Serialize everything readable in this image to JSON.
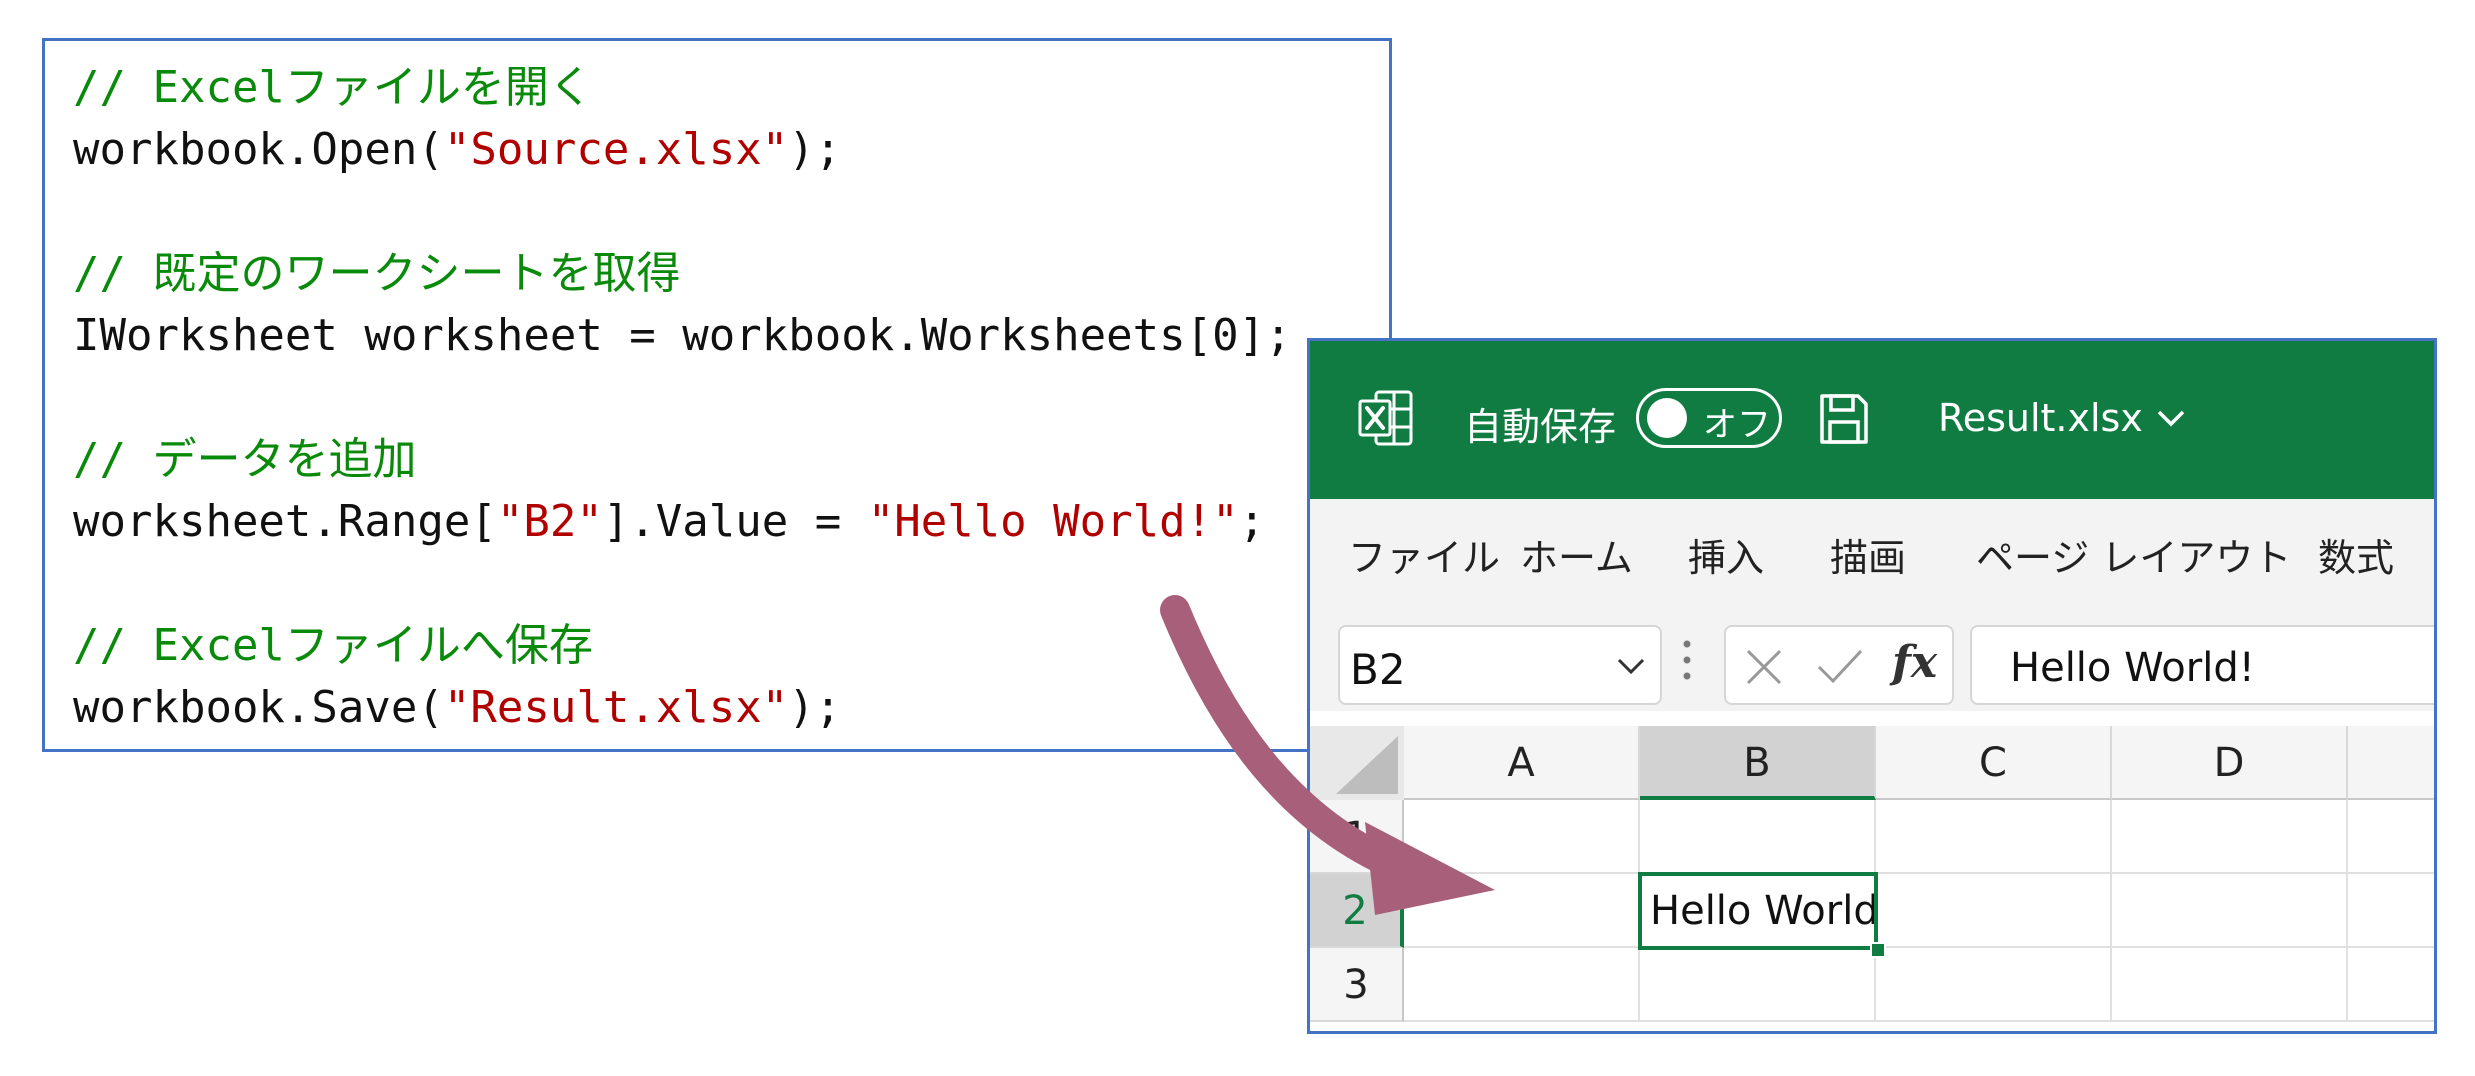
{
  "code": {
    "comment1": "// Excelファイルを開く",
    "line1_pre": "workbook.Open(",
    "line1_str": "\"Source.xlsx\"",
    "line1_post": ");",
    "comment2": "// 既定のワークシートを取得",
    "line2": "IWorksheet worksheet = workbook.Worksheets[0];",
    "comment3": "// データを追加",
    "line3_pre": "worksheet.Range[",
    "line3_str1": "\"B2\"",
    "line3_mid": "].Value = ",
    "line3_str2": "\"Hello World!\"",
    "line3_post": ";",
    "comment4": "// Excelファイルへ保存",
    "line4_pre": "workbook.Save(",
    "line4_str": "\"Result.xlsx\"",
    "line4_post": ");"
  },
  "excel": {
    "autosave_label": "自動保存",
    "autosave_state": "オフ",
    "filename": "Result.xlsx",
    "menu": [
      "ファイル",
      "ホーム",
      "挿入",
      "描画",
      "ページ レイアウト",
      "数式"
    ],
    "namebox": "B2",
    "formula": "Hello World!",
    "columns": [
      "A",
      "B",
      "C",
      "D"
    ],
    "rows": [
      "1",
      "2",
      "3"
    ],
    "cell_b2": "Hello World!",
    "brand_color": "#107c41"
  },
  "colors": {
    "comment": "#0a8a0a",
    "string": "#b00000",
    "panel_border": "#4472c4",
    "arrow": "#a8607a"
  }
}
